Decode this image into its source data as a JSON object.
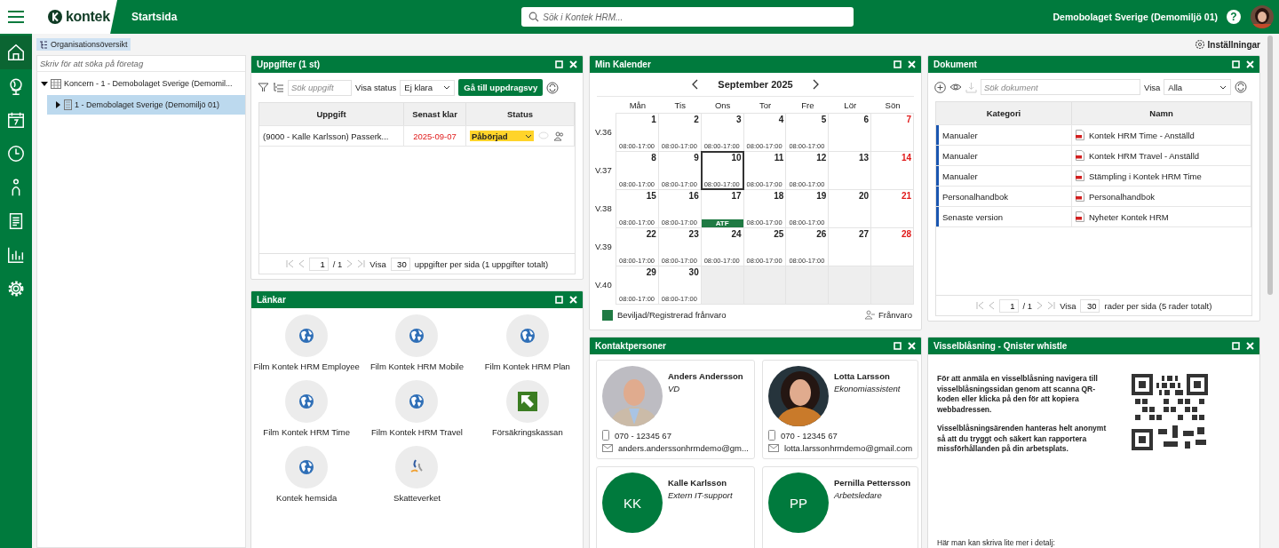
{
  "topbar": {
    "logo": "kontek",
    "page_title": "Startsida",
    "search": {
      "placeholder": "Sök i Kontek HRM..."
    },
    "company": "Demobolaget Sverige (Demomiljö 01)",
    "help": "?"
  },
  "sidebar": {
    "items": [
      {
        "kind": "home",
        "selected": true
      },
      {
        "kind": "globe",
        "selected": false
      },
      {
        "kind": "calendar",
        "selected": false
      },
      {
        "kind": "clock",
        "selected": false
      },
      {
        "kind": "person",
        "selected": false
      },
      {
        "kind": "document",
        "selected": false
      },
      {
        "kind": "chart",
        "selected": false
      },
      {
        "kind": "gear",
        "selected": false
      }
    ]
  },
  "org_tree": {
    "tab": "Organisationsöversikt",
    "search": {
      "placeholder": "Skriv för att söka på företag"
    },
    "nodes": [
      {
        "label": "Koncern - 1 - Demobolaget Sverige (Demomil...",
        "expanded": true,
        "selected": false,
        "children": [
          {
            "label": "1 - Demobolaget Sverige (Demomiljö 01)",
            "expanded": false,
            "selected": true
          }
        ]
      }
    ]
  },
  "settings_link": "Inställningar",
  "tasks": {
    "title": "Uppgifter (1 st)",
    "search": {
      "placeholder": "Sök uppgift"
    },
    "status_label": "Visa status",
    "status_value": "Ej klara",
    "action": "Gå till uppdragsvy",
    "columns": [
      "Uppgift",
      "Senast klar",
      "Status"
    ],
    "rows": [
      {
        "task": "(9000 - Kalle Karlsson) Passerk...",
        "due": "2025-09-07",
        "overdue": true,
        "status": "Påbörjad"
      }
    ],
    "pager": {
      "page": "1",
      "pages": "/ 1",
      "show": "Visa",
      "per_page": "30",
      "summary": "uppgifter per sida (1 uppgifter totalt)"
    }
  },
  "links": {
    "title": "Länkar",
    "items": [
      {
        "label": "Film Kontek HRM Employee",
        "kind": "globe"
      },
      {
        "label": "Film Kontek HRM Mobile",
        "kind": "globe"
      },
      {
        "label": "Film Kontek HRM Plan",
        "kind": "globe"
      },
      {
        "label": "Film Kontek HRM Time",
        "kind": "globe"
      },
      {
        "label": "Film Kontek HRM Travel",
        "kind": "globe"
      },
      {
        "label": "Försäkringskassan",
        "kind": "arrow"
      },
      {
        "label": "Kontek hemsida",
        "kind": "globe"
      },
      {
        "label": "Skatteverket",
        "kind": "swirl"
      }
    ]
  },
  "calendar": {
    "title": "Min Kalender",
    "month": "September 2025",
    "weekdays": [
      "Mån",
      "Tis",
      "Ons",
      "Tor",
      "Fre",
      "Lör",
      "Sön"
    ],
    "weeks": [
      {
        "label": "V.36",
        "days": [
          {
            "date": "1",
            "hours": "08:00-17:00",
            "holiday": false,
            "today": false
          },
          {
            "date": "2",
            "hours": "08:00-17:00",
            "holiday": false,
            "today": false
          },
          {
            "date": "3",
            "hours": "08:00-17:00",
            "holiday": false,
            "today": false
          },
          {
            "date": "4",
            "hours": "08:00-17:00",
            "holiday": false,
            "today": false
          },
          {
            "date": "5",
            "hours": "08:00-17:00",
            "holiday": false,
            "today": false
          },
          {
            "date": "6",
            "holiday": false,
            "today": false
          },
          {
            "date": "7",
            "holiday": true,
            "today": false
          }
        ]
      },
      {
        "label": "V.37",
        "days": [
          {
            "date": "8",
            "hours": "08:00-17:00",
            "holiday": false,
            "today": false
          },
          {
            "date": "9",
            "hours": "08:00-17:00",
            "holiday": false,
            "today": false
          },
          {
            "date": "10",
            "hours": "08:00-17:00",
            "holiday": false,
            "today": true
          },
          {
            "date": "11",
            "hours": "08:00-17:00",
            "holiday": false,
            "today": false
          },
          {
            "date": "12",
            "hours": "08:00-17:00",
            "holiday": false,
            "today": false
          },
          {
            "date": "13",
            "holiday": false,
            "today": false
          },
          {
            "date": "14",
            "holiday": true,
            "today": false
          }
        ]
      },
      {
        "label": "V.38",
        "days": [
          {
            "date": "15",
            "hours": "08:00-17:00",
            "holiday": false,
            "today": false
          },
          {
            "date": "16",
            "hours": "08:00-17:00",
            "holiday": false,
            "today": false
          },
          {
            "date": "17",
            "event": "ATF",
            "holiday": false,
            "today": false
          },
          {
            "date": "18",
            "hours": "08:00-17:00",
            "holiday": false,
            "today": false
          },
          {
            "date": "19",
            "hours": "08:00-17:00",
            "holiday": false,
            "today": false
          },
          {
            "date": "20",
            "holiday": false,
            "today": false
          },
          {
            "date": "21",
            "holiday": true,
            "today": false
          }
        ]
      },
      {
        "label": "V.39",
        "days": [
          {
            "date": "22",
            "hours": "08:00-17:00",
            "holiday": false,
            "today": false
          },
          {
            "date": "23",
            "hours": "08:00-17:00",
            "holiday": false,
            "today": false
          },
          {
            "date": "24",
            "hours": "08:00-17:00",
            "holiday": false,
            "today": false
          },
          {
            "date": "25",
            "hours": "08:00-17:00",
            "holiday": false,
            "today": false
          },
          {
            "date": "26",
            "hours": "08:00-17:00",
            "holiday": false,
            "today": false
          },
          {
            "date": "27",
            "holiday": false,
            "today": false
          },
          {
            "date": "28",
            "holiday": true,
            "today": false
          }
        ]
      },
      {
        "label": "V.40",
        "days": [
          {
            "date": "29",
            "hours": "08:00-17:00",
            "holiday": false,
            "today": false
          },
          {
            "date": "30",
            "hours": "08:00-17:00",
            "holiday": false,
            "today": false
          }
        ]
      }
    ],
    "legend": "Beviljad/Registrerad frånvaro",
    "absence_link": "Frånvaro"
  },
  "documents": {
    "title": "Dokument",
    "search": {
      "placeholder": "Sök dokument"
    },
    "show_label": "Visa",
    "show_value": "Alla",
    "columns": [
      "Kategori",
      "Namn"
    ],
    "rows": [
      {
        "category": "Manualer",
        "name": "Kontek HRM Time - Anställd"
      },
      {
        "category": "Manualer",
        "name": "Kontek HRM Travel - Anställd"
      },
      {
        "category": "Manualer",
        "name": "Stämpling i Kontek HRM Time"
      },
      {
        "category": "Personalhandbok",
        "name": "Personalhandbok"
      },
      {
        "category": "Senaste version",
        "name": "Nyheter Kontek HRM"
      }
    ],
    "pager": {
      "page": "1",
      "pages": "/ 1",
      "show": "Visa",
      "per_page": "30",
      "summary": "rader per sida (5 rader totalt)"
    }
  },
  "contacts": {
    "title": "Kontaktpersoner",
    "people": [
      {
        "name": "Anders Andersson",
        "role": "VD",
        "phone": "070 - 12345 67",
        "email": "anders.anderssonhrmdemo@gm..."
      },
      {
        "name": "Lotta Larsson",
        "role": "Ekonomiassistent",
        "phone": "070 - 12345 67",
        "email": "lotta.larssonhrmdemo@gmail.com"
      },
      {
        "kind": "initials",
        "initials": "KK",
        "name": "Kalle Karlsson",
        "role": "Extern IT-support"
      },
      {
        "kind": "initials",
        "initials": "PP",
        "name": "Pernilla Pettersson",
        "role": "Arbetsledare"
      }
    ]
  },
  "whistle": {
    "title": "Visselblåsning - Qnister whistle",
    "paragraphs": [
      "För att anmäla en visselblåsning navigera till visselblåsningssidan genom att scanna QR-koden eller klicka på den för att kopiera webbadressen.",
      "Visselblåsningsärenden hanteras helt anonymt så att du tryggt och säkert kan rapportera missförhållanden på din arbetsplats."
    ],
    "note": "Här man kan skriva lite mer i detalj:"
  }
}
